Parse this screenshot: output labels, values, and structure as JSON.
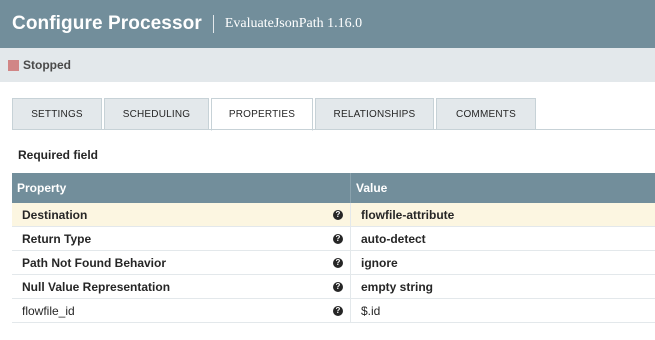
{
  "header": {
    "title": "Configure Processor",
    "subtitle": "EvaluateJsonPath 1.16.0"
  },
  "status": {
    "text": "Stopped",
    "icon": "stop-square-icon",
    "color": "#d18686"
  },
  "tabs": [
    {
      "label": "SETTINGS"
    },
    {
      "label": "SCHEDULING"
    },
    {
      "label": "PROPERTIES",
      "active": true
    },
    {
      "label": "RELATIONSHIPS"
    },
    {
      "label": "COMMENTS"
    }
  ],
  "required_label": "Required field",
  "table": {
    "headers": [
      "Property",
      "Value"
    ],
    "rows": [
      {
        "property": "Destination",
        "value": "flowfile-attribute",
        "required": true,
        "selected": true
      },
      {
        "property": "Return Type",
        "value": "auto-detect",
        "required": true
      },
      {
        "property": "Path Not Found Behavior",
        "value": "ignore",
        "required": true
      },
      {
        "property": "Null Value Representation",
        "value": "empty string",
        "required": true
      },
      {
        "property": "flowfile_id",
        "value": "$.id",
        "required": false
      }
    ],
    "help_glyph": "?"
  },
  "colors": {
    "header_bg": "#728e9b",
    "status_bg": "#e3e8eb",
    "selected_row": "#fcf6e1"
  }
}
